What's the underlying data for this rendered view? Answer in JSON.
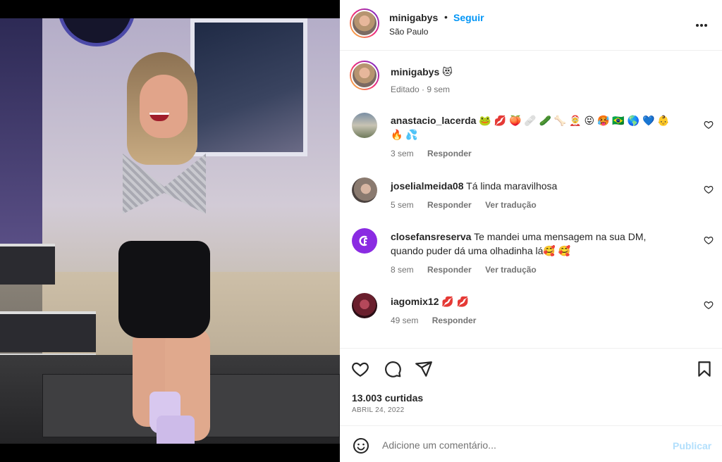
{
  "post": {
    "author": "minigabys",
    "follow_label": "Seguir",
    "separator": "•",
    "location": "São Paulo",
    "more_label": "•••"
  },
  "caption": {
    "author": "minigabys",
    "text": "😻",
    "edited": "Editado · 9 sem"
  },
  "comments": [
    {
      "author": "anastacio_lacerda",
      "text": "🐸 💋 🍑 🩹 🥒 🦴 🤶 😝 🥵 🇧🇷 🌎 💙 👶 🔥 💦",
      "time": "3 sem",
      "reply_label": "Responder",
      "translate_label": ""
    },
    {
      "author": "joselialmeida08",
      "text": "Tá linda maravilhosa",
      "time": "5 sem",
      "reply_label": "Responder",
      "translate_label": "Ver tradução"
    },
    {
      "author": "closefansreserva",
      "text": "Te mandei uma mensagem na sua DM, quando puder dá uma olhadinha lá🥰 🥰",
      "time": "8 sem",
      "reply_label": "Responder",
      "translate_label": "Ver tradução"
    },
    {
      "author": "iagomix12",
      "text": "💋 💋",
      "time": "49 sem",
      "reply_label": "Responder",
      "translate_label": ""
    }
  ],
  "engagement": {
    "likes": "13.003 curtidas",
    "date": "ABRIL 24, 2022"
  },
  "composer": {
    "placeholder": "Adicione um comentário...",
    "publish_label": "Publicar"
  },
  "icons": {
    "like": "heart-icon",
    "comment": "comment-icon",
    "share": "send-icon",
    "save": "bookmark-icon",
    "emoji": "emoji-icon",
    "more": "more-icon"
  },
  "colors": {
    "link_blue": "#0095f6",
    "publish_disabled": "#b2dffc",
    "meta_gray": "#737373"
  }
}
